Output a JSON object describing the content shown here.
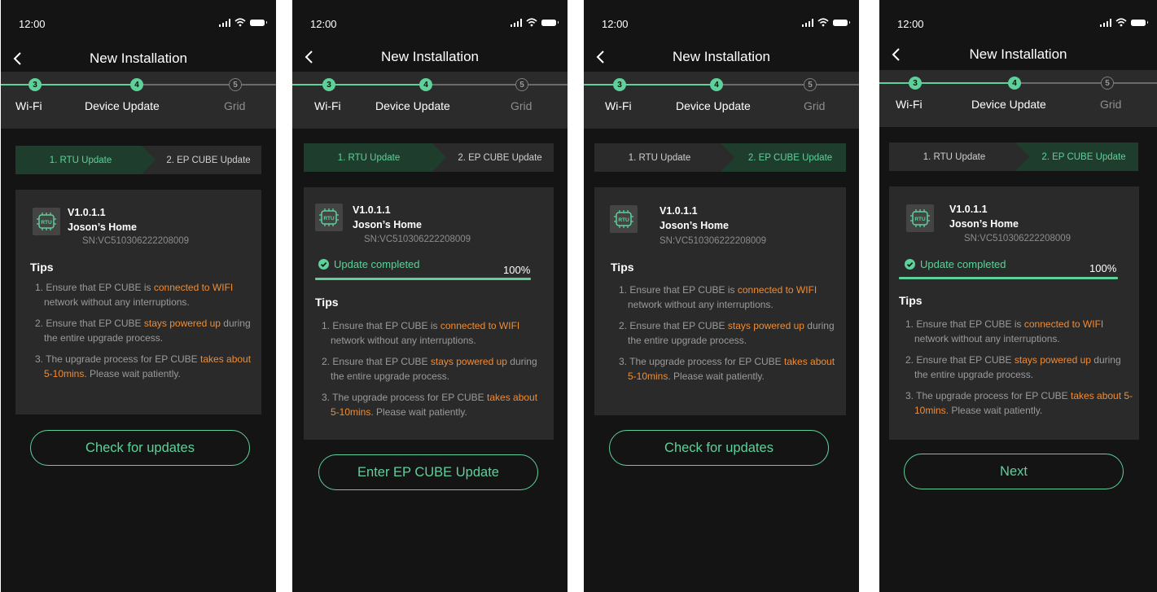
{
  "status": {
    "time": "12:00"
  },
  "nav": {
    "title": "New Installation"
  },
  "steps": [
    {
      "number": "3",
      "label": "Wi-Fi",
      "state": "done"
    },
    {
      "number": "4",
      "label": "Device Update",
      "state": "current"
    },
    {
      "number": "5",
      "label": "Grid",
      "state": "pending"
    }
  ],
  "substeps": [
    "1. RTU Update",
    "2. EP CUBE Update"
  ],
  "device": {
    "icon_text": "RTU",
    "version": "V1.0.1.1",
    "home": "Joson’s Home",
    "sn": "SN:VC510306222208009"
  },
  "progress": {
    "label": "Update completed",
    "percent_text": "100%",
    "fraction": 1.0
  },
  "tips": {
    "heading": "Tips",
    "items": [
      {
        "num": "1.",
        "pre": "Ensure that EP CUBE is ",
        "hl": "connected to WIFI",
        "post": " network without any interruptions."
      },
      {
        "num": "2.",
        "pre": "Ensure that EP CUBE ",
        "hl": "stays powered up",
        "post": " during the entire upgrade process."
      },
      {
        "num": "3.",
        "pre": "The upgrade process for EP CUBE ",
        "hl": "takes about 5-10mins",
        "post": ". Please wait patiently."
      }
    ]
  },
  "buttons": {
    "check": "Check for updates",
    "enter": "Enter EP CUBE Update",
    "next": "Next"
  },
  "colors": {
    "accent": "#5ed19a",
    "highlight": "#f08c32",
    "screen_bg": "#141414",
    "card_bg": "#2a2a2a",
    "sub_active_bg": "#1f3d2c"
  }
}
